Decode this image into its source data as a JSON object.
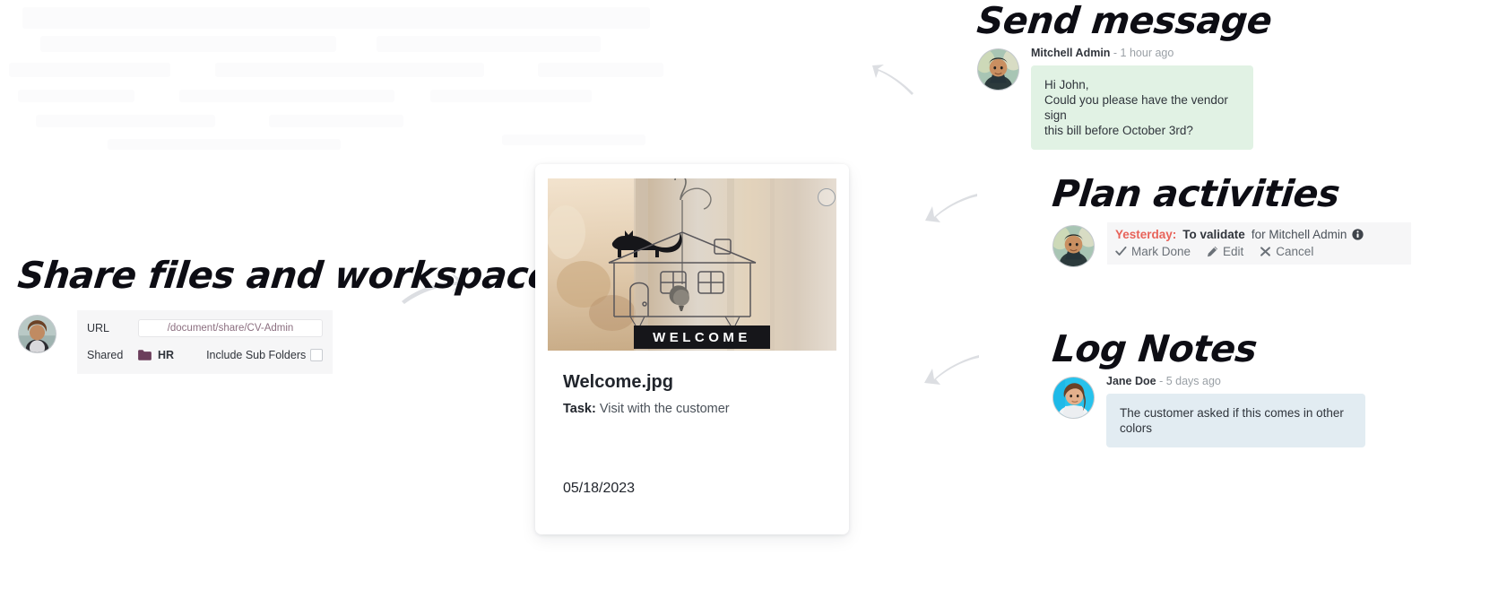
{
  "share": {
    "title": "Share files and workspace",
    "url_label": "URL",
    "url_value": "/document/share/CV-Admin",
    "shared_label": "Shared",
    "folder_name": "HR",
    "include_sub_folders_label": "Include Sub Folders",
    "include_sub_folders_checked": false,
    "folder_color": "#6b3d5b",
    "url_text_color": "#8c6f80"
  },
  "card": {
    "filename": "Welcome.jpg",
    "task_label": "Task:",
    "task_value": "Visit with the customer",
    "date": "05/18/2023",
    "thumb_caption": "WELCOME",
    "selected": false
  },
  "send_message": {
    "title": "Send message",
    "author": "Mitchell Admin",
    "timestamp": "- 1 hour ago",
    "body": "Hi John,\nCould you please have the vendor sign\nthis bill  before October 3rd?",
    "bubble_color": "#e1f2e4"
  },
  "plan_activities": {
    "title": "Plan activities",
    "when": "Yesterday:",
    "summary": "To validate",
    "assignee": "for Mitchell Admin",
    "info_icon": "info-icon",
    "actions": [
      {
        "label": "Mark Done",
        "icon": "check-icon"
      },
      {
        "label": "Edit",
        "icon": "pencil-icon"
      },
      {
        "label": "Cancel",
        "icon": "cross-icon"
      }
    ],
    "when_color": "#e8635a"
  },
  "log_notes": {
    "title": "Log Notes",
    "author": "Jane Doe",
    "timestamp": "- 5 days ago",
    "body": "The customer asked if this comes in other colors",
    "bubble_color": "#e2ecf2"
  },
  "arrows": {
    "share_to_card": "arrow-right-icon",
    "card_to_send": "arrow-up-left-icon",
    "card_to_plan": "arrow-down-left-icon",
    "card_to_log": "arrow-down-left-icon-2"
  }
}
